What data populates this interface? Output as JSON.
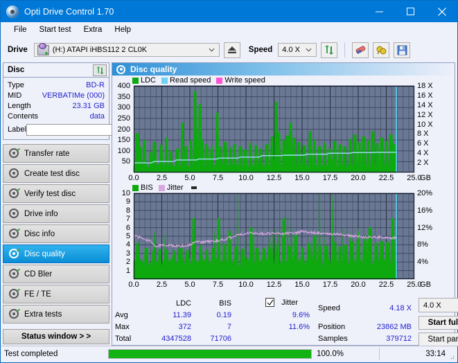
{
  "window": {
    "title": "Opti Drive Control 1.70",
    "icon": "disc-icon",
    "minimize": "–",
    "maximize": "□",
    "close": "✕"
  },
  "menubar": {
    "items": [
      {
        "label": "File"
      },
      {
        "label": "Start test"
      },
      {
        "label": "Extra"
      },
      {
        "label": "Help"
      }
    ]
  },
  "toolbar": {
    "drive_label": "Drive",
    "drive_value": "(H:)  ATAPI iHBS112  2 CL0K",
    "eject_title": "eject-icon",
    "speed_label": "Speed",
    "speed_value": "4.0 X",
    "refresh_icon": "refresh-arrows-icon",
    "eraser_icon": "eraser-icon",
    "bulb_icon": "bulb-icon",
    "save_icon": "save-floppy-icon"
  },
  "sidebar": {
    "disc_panel": {
      "title": "Disc",
      "refresh_icon": "refresh-arrows-icon",
      "rows": [
        {
          "key": "Type",
          "value": "BD-R"
        },
        {
          "key": "MID",
          "value": "VERBATIMe (000)"
        },
        {
          "key": "Length",
          "value": "23.31 GB"
        },
        {
          "key": "Contents",
          "value": "data"
        }
      ],
      "label_key": "Label",
      "label_value": "",
      "label_placeholder": "",
      "label_button_icon": "cd-disc-icon"
    },
    "nav": [
      {
        "label": "Transfer rate",
        "active": false
      },
      {
        "label": "Create test disc",
        "active": false
      },
      {
        "label": "Verify test disc",
        "active": false
      },
      {
        "label": "Drive info",
        "active": false
      },
      {
        "label": "Disc info",
        "active": false
      },
      {
        "label": "Disc quality",
        "active": true
      },
      {
        "label": "CD Bler",
        "active": false
      },
      {
        "label": "FE / TE",
        "active": false
      },
      {
        "label": "Extra tests",
        "active": false
      }
    ],
    "status_window_button": "Status window > >"
  },
  "content": {
    "header": "Disc quality",
    "header_icon": "disc-quality-icon"
  },
  "chart_data": [
    {
      "type": "line",
      "id": "ldc-chart",
      "title": "",
      "legend": [
        {
          "name": "LDC",
          "color": "#0ea90e"
        },
        {
          "name": "Read speed",
          "color": "#6fd2f5"
        },
        {
          "name": "Write speed",
          "color": "#ff55d5"
        }
      ],
      "legend_position": "top-left",
      "xlabel": "GB",
      "x_ticks": [
        "0.0",
        "2.5",
        "5.0",
        "7.5",
        "10.0",
        "12.5",
        "15.0",
        "17.5",
        "20.0",
        "22.5",
        "25.0"
      ],
      "xlim": [
        0,
        25
      ],
      "ylabel": "",
      "y_ticks": [
        50,
        100,
        150,
        200,
        250,
        300,
        350,
        400
      ],
      "ylim": [
        0,
        400
      ],
      "y2label": "",
      "y2_ticks": [
        "2 X",
        "4 X",
        "6 X",
        "8 X",
        "10 X",
        "12 X",
        "14 X",
        "16 X",
        "18 X"
      ],
      "y2lim": [
        0,
        18
      ],
      "grid": true,
      "plot_bg": "#6a7894",
      "data_end_gb": 23.4,
      "series": [
        {
          "name": "LDC",
          "type": "spike-area",
          "color": "#0ea90e",
          "baseline": 40,
          "peaks": [
            [
              0.3,
              180
            ],
            [
              0.55,
              120
            ],
            [
              0.95,
              150
            ],
            [
              1.5,
              95
            ],
            [
              1.85,
              140
            ],
            [
              2.45,
              125
            ],
            [
              2.95,
              160
            ],
            [
              3.3,
              100
            ],
            [
              3.9,
              110
            ],
            [
              4.35,
              230
            ],
            [
              4.65,
              120
            ],
            [
              5.1,
              150
            ],
            [
              5.45,
              375
            ],
            [
              5.6,
              195
            ],
            [
              5.9,
              315
            ],
            [
              6.05,
              150
            ],
            [
              6.45,
              130
            ],
            [
              6.95,
              110
            ],
            [
              7.45,
              275
            ],
            [
              7.75,
              120
            ],
            [
              8.15,
              140
            ],
            [
              8.6,
              115
            ],
            [
              9.0,
              130
            ],
            [
              9.5,
              120
            ],
            [
              9.95,
              105
            ],
            [
              10.4,
              135
            ],
            [
              10.9,
              125
            ],
            [
              11.3,
              110
            ],
            [
              11.85,
              130
            ],
            [
              12.3,
              165
            ],
            [
              12.7,
              325
            ],
            [
              12.95,
              185
            ],
            [
              13.35,
              150
            ],
            [
              13.7,
              170
            ],
            [
              14.0,
              230
            ],
            [
              14.3,
              160
            ],
            [
              14.7,
              140
            ],
            [
              15.2,
              125
            ],
            [
              15.7,
              190
            ],
            [
              16.1,
              150
            ],
            [
              16.55,
              120
            ],
            [
              17.0,
              135
            ],
            [
              17.45,
              110
            ],
            [
              17.9,
              145
            ],
            [
              18.4,
              130
            ],
            [
              18.8,
              120
            ],
            [
              19.3,
              155
            ],
            [
              19.7,
              175
            ],
            [
              20.1,
              140
            ],
            [
              20.5,
              165
            ],
            [
              20.9,
              150
            ],
            [
              21.3,
              190
            ],
            [
              21.7,
              135
            ],
            [
              22.1,
              160
            ],
            [
              22.5,
              145
            ],
            [
              22.9,
              175
            ],
            [
              23.2,
              130
            ]
          ]
        },
        {
          "name": "Read speed",
          "type": "step-line",
          "color": "#9fdff7",
          "points": [
            [
              0.0,
              2.0
            ],
            [
              1.6,
              2.0
            ],
            [
              1.8,
              2.3
            ],
            [
              3.6,
              2.3
            ],
            [
              3.8,
              2.6
            ],
            [
              5.6,
              2.6
            ],
            [
              5.8,
              2.8
            ],
            [
              7.4,
              2.8
            ],
            [
              7.6,
              3.0
            ],
            [
              9.3,
              3.0
            ],
            [
              9.5,
              3.2
            ],
            [
              11.2,
              3.2
            ],
            [
              11.4,
              3.5
            ],
            [
              13.2,
              3.5
            ],
            [
              13.4,
              3.6
            ],
            [
              15.2,
              3.6
            ],
            [
              15.4,
              3.8
            ],
            [
              17.2,
              3.8
            ],
            [
              17.4,
              4.0
            ],
            [
              19.3,
              4.0
            ],
            [
              19.5,
              4.15
            ],
            [
              21.3,
              4.15
            ],
            [
              21.5,
              4.2
            ],
            [
              23.4,
              4.2
            ]
          ]
        }
      ],
      "marker_line": {
        "x": 23.4,
        "color": "#4fd8f5"
      }
    },
    {
      "type": "line",
      "id": "bis-chart",
      "title": "",
      "legend": [
        {
          "name": "BIS",
          "color": "#0ea90e"
        },
        {
          "name": "Jitter",
          "color": "#d8a8e0"
        }
      ],
      "legend_position": "top-left",
      "xlabel": "GB",
      "x_ticks": [
        "0.0",
        "2.5",
        "5.0",
        "7.5",
        "10.0",
        "12.5",
        "15.0",
        "17.5",
        "20.0",
        "22.5",
        "25.0"
      ],
      "xlim": [
        0,
        25
      ],
      "ylabel": "",
      "y_ticks": [
        1,
        2,
        3,
        4,
        5,
        6,
        7,
        8,
        9,
        10
      ],
      "ylim": [
        0,
        10
      ],
      "y2_ticks": [
        "4%",
        "8%",
        "12%",
        "16%",
        "20%"
      ],
      "y2lim": [
        0,
        20
      ],
      "grid": true,
      "plot_bg": "#6a7894",
      "data_end_gb": 23.4,
      "series": [
        {
          "name": "BIS",
          "type": "spike-area",
          "color": "#0ea90e",
          "baseline": 2.6,
          "peaks": [
            [
              0.35,
              4.2
            ],
            [
              1.1,
              3.6
            ],
            [
              1.75,
              3.3
            ],
            [
              2.3,
              3.5
            ],
            [
              2.95,
              3.4
            ],
            [
              3.6,
              3.3
            ],
            [
              4.2,
              3.6
            ],
            [
              4.8,
              3.4
            ],
            [
              5.35,
              7.1
            ],
            [
              5.95,
              3.6
            ],
            [
              6.5,
              3.4
            ],
            [
              7.1,
              3.6
            ],
            [
              7.55,
              7.1
            ],
            [
              8.1,
              4.0
            ],
            [
              8.55,
              5.6
            ],
            [
              9.1,
              3.8
            ],
            [
              9.7,
              3.5
            ],
            [
              10.45,
              6.0
            ],
            [
              11.0,
              3.6
            ],
            [
              11.6,
              3.5
            ],
            [
              12.2,
              3.7
            ],
            [
              12.8,
              4.0
            ],
            [
              13.35,
              7.1
            ],
            [
              13.9,
              3.8
            ],
            [
              14.45,
              5.0
            ],
            [
              15.05,
              3.7
            ],
            [
              15.6,
              4.2
            ],
            [
              16.1,
              5.0
            ],
            [
              16.65,
              3.8
            ],
            [
              17.2,
              3.9
            ],
            [
              17.8,
              4.3
            ],
            [
              18.35,
              3.8
            ],
            [
              18.9,
              4.0
            ],
            [
              19.45,
              4.4
            ],
            [
              20.0,
              4.6
            ],
            [
              20.55,
              4.2
            ],
            [
              21.05,
              6.0
            ],
            [
              21.6,
              4.2
            ],
            [
              22.1,
              4.4
            ],
            [
              22.6,
              4.3
            ],
            [
              23.05,
              7.1
            ]
          ]
        },
        {
          "name": "Jitter",
          "type": "noisy-line",
          "color": "#d8a8e0",
          "points": [
            [
              0.0,
              5.0
            ],
            [
              0.5,
              4.9
            ],
            [
              1.0,
              4.6
            ],
            [
              1.5,
              4.5
            ],
            [
              1.8,
              3.9
            ],
            [
              2.5,
              3.9
            ],
            [
              3.5,
              3.9
            ],
            [
              4.5,
              3.9
            ],
            [
              5.0,
              4.0
            ],
            [
              5.5,
              4.3
            ],
            [
              6.0,
              4.3
            ],
            [
              6.5,
              4.4
            ],
            [
              7.0,
              4.4
            ],
            [
              7.5,
              4.5
            ],
            [
              8.0,
              4.6
            ],
            [
              8.5,
              4.8
            ],
            [
              9.0,
              5.0
            ],
            [
              9.5,
              5.2
            ],
            [
              10.0,
              5.3
            ],
            [
              10.5,
              5.4
            ],
            [
              11.0,
              5.3
            ],
            [
              11.5,
              5.3
            ],
            [
              12.0,
              5.3
            ],
            [
              12.5,
              5.4
            ],
            [
              13.0,
              5.3
            ],
            [
              13.5,
              5.3
            ],
            [
              14.0,
              5.4
            ],
            [
              14.5,
              5.4
            ],
            [
              15.0,
              5.6
            ],
            [
              15.5,
              5.5
            ],
            [
              16.0,
              5.4
            ],
            [
              16.5,
              5.4
            ],
            [
              17.0,
              5.3
            ],
            [
              17.5,
              5.3
            ],
            [
              18.0,
              5.2
            ],
            [
              18.5,
              5.2
            ],
            [
              19.0,
              5.1
            ],
            [
              19.5,
              5.0
            ],
            [
              20.0,
              5.0
            ],
            [
              20.5,
              4.9
            ],
            [
              21.0,
              4.9
            ],
            [
              21.5,
              4.9
            ],
            [
              22.0,
              4.9
            ],
            [
              22.5,
              4.8
            ],
            [
              23.0,
              4.8
            ],
            [
              23.4,
              4.8
            ]
          ]
        }
      ],
      "marker_line": {
        "x": 23.4,
        "color": "#4fd8f5"
      }
    }
  ],
  "stats": {
    "columns": [
      "LDC",
      "BIS"
    ],
    "jitter_label": "Jitter",
    "jitter_checked": true,
    "rows": [
      {
        "label": "Avg",
        "ldc": "11.39",
        "bis": "0.19",
        "jitter": "9.6%"
      },
      {
        "label": "Max",
        "ldc": "372",
        "bis": "7",
        "jitter": "11.6%"
      },
      {
        "label": "Total",
        "ldc": "4347528",
        "bis": "71706",
        "jitter": ""
      }
    ],
    "right": [
      {
        "label": "Speed",
        "value": "4.18 X"
      },
      {
        "label": "Position",
        "value": "23862 MB"
      },
      {
        "label": "Samples",
        "value": "379712"
      }
    ],
    "speed_select": "4.0 X",
    "start_full": "Start full",
    "start_part": "Start part"
  },
  "statusbar": {
    "text": "Test completed",
    "progress": 100,
    "percent": "100.0%",
    "time": "33:14"
  }
}
